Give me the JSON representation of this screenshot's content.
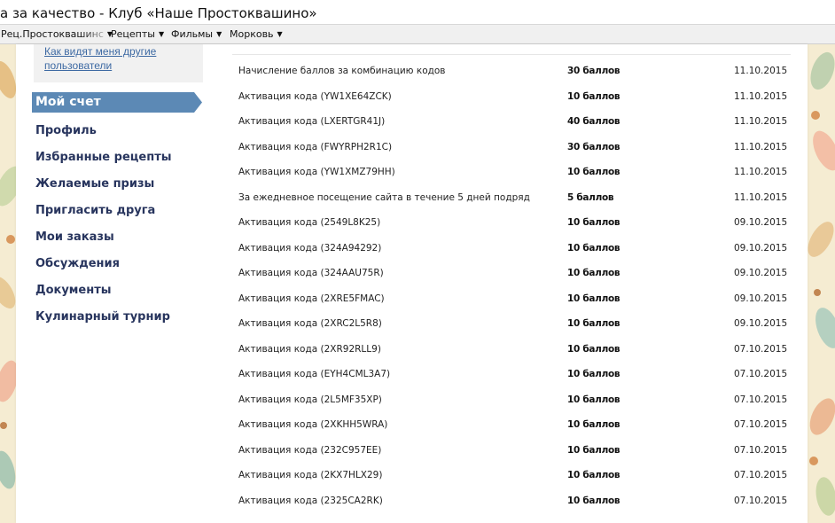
{
  "window": {
    "title": "а за качество - Клуб «Наше Простоквашино»"
  },
  "bookmarks": [
    {
      "label": "Рец.Простоквашинс"
    },
    {
      "label": "Рецепты"
    },
    {
      "label": "Фильмы"
    },
    {
      "label": "Морковь"
    }
  ],
  "sidebar": {
    "top_link": "Как видят меня другие пользователи",
    "active_item": "Мой счет",
    "items": [
      {
        "label": "Профиль"
      },
      {
        "label": "Избранные рецепты"
      },
      {
        "label": "Желаемые призы"
      },
      {
        "label": "Пригласить друга"
      },
      {
        "label": "Мои заказы"
      },
      {
        "label": "Обсуждения"
      },
      {
        "label": "Документы"
      },
      {
        "label": "Кулинарный турнир"
      }
    ]
  },
  "points_table": {
    "rows": [
      {
        "description": "Начисление баллов за комбинацию кодов",
        "points": "30 баллов",
        "date": "11.10.2015"
      },
      {
        "description": "Активация кода (YW1XE64ZCK)",
        "points": "10 баллов",
        "date": "11.10.2015"
      },
      {
        "description": "Активация кода (LXERTGR41J)",
        "points": "40 баллов",
        "date": "11.10.2015"
      },
      {
        "description": "Активация кода (FWYRPH2R1C)",
        "points": "30 баллов",
        "date": "11.10.2015"
      },
      {
        "description": "Активация кода (YW1XMZ79HH)",
        "points": "10 баллов",
        "date": "11.10.2015"
      },
      {
        "description": "За ежедневное посещение сайта в течение 5 дней подряд",
        "points": "5 баллов",
        "date": "11.10.2015"
      },
      {
        "description": "Активация кода (2549L8K25)",
        "points": "10 баллов",
        "date": "09.10.2015"
      },
      {
        "description": "Активация кода (324A94292)",
        "points": "10 баллов",
        "date": "09.10.2015"
      },
      {
        "description": "Активация кода (324AAU75R)",
        "points": "10 баллов",
        "date": "09.10.2015"
      },
      {
        "description": "Активация кода (2XRE5FMAC)",
        "points": "10 баллов",
        "date": "09.10.2015"
      },
      {
        "description": "Активация кода (2XRC2L5R8)",
        "points": "10 баллов",
        "date": "09.10.2015"
      },
      {
        "description": "Активация кода (2XR92RLL9)",
        "points": "10 баллов",
        "date": "07.10.2015"
      },
      {
        "description": "Активация кода (EYH4CML3A7)",
        "points": "10 баллов",
        "date": "07.10.2015"
      },
      {
        "description": "Активация кода (2L5MF35XP)",
        "points": "10 баллов",
        "date": "07.10.2015"
      },
      {
        "description": "Активация кода (2XKHH5WRA)",
        "points": "10 баллов",
        "date": "07.10.2015"
      },
      {
        "description": "Активация кода (232C957EE)",
        "points": "10 баллов",
        "date": "07.10.2015"
      },
      {
        "description": "Активация кода (2KX7HLX29)",
        "points": "10 баллов",
        "date": "07.10.2015"
      },
      {
        "description": "Активация кода (2325CA2RK)",
        "points": "10 баллов",
        "date": "07.10.2015"
      }
    ]
  },
  "colors": {
    "accent": "#5c89b5",
    "nav_text": "#28355e",
    "link": "#3e6aa3",
    "background": "#f5ecd2"
  }
}
